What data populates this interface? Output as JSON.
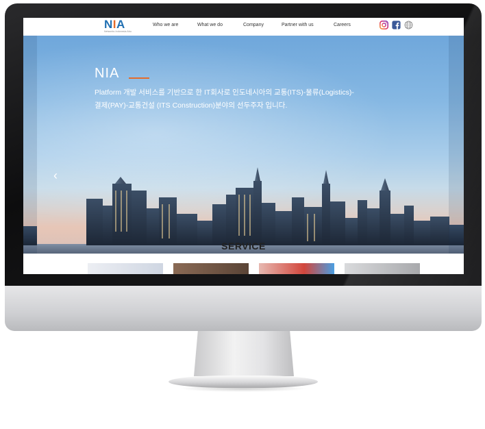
{
  "site": {
    "logo": {
      "n": "N",
      "i": "I",
      "a": "A",
      "tagline": "Networks Indonesia Abu"
    },
    "nav": [
      "Who we are",
      "What we do",
      "Company",
      "Partner with us",
      "Careers"
    ],
    "social": [
      "instagram-icon",
      "facebook-icon",
      "globe-icon"
    ]
  },
  "hero": {
    "title": "NIA",
    "line1": "Platform 개발 서비스를 기반으로 한 IT회사로 인도네시아의 교통(ITS)-물류(Logistics)-",
    "line2": "결제(PAY)-교통건설 (ITS Construction)분야의 선두주자 입니다.",
    "prev_icon": "‹"
  },
  "service": {
    "title": "SERVICE"
  },
  "colors": {
    "brand_blue": "#1f6fb2",
    "brand_orange": "#e46b2a"
  }
}
